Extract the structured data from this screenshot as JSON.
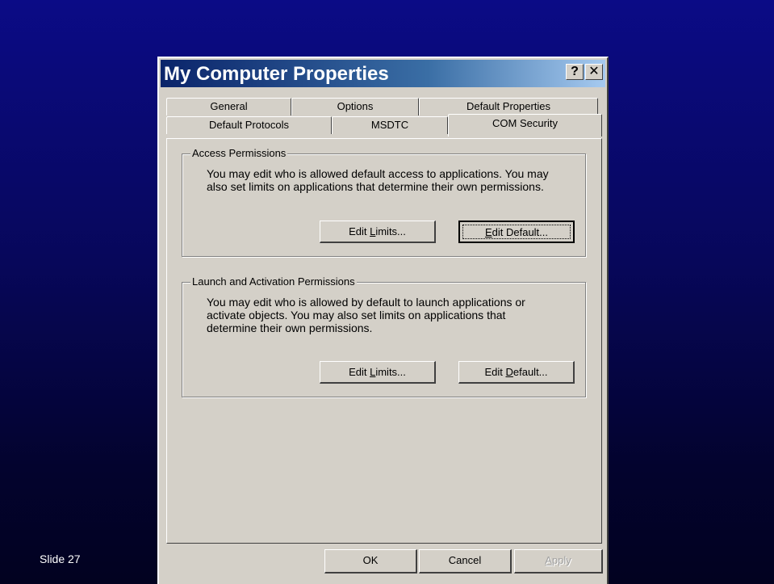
{
  "slide": {
    "label": "Slide 27"
  },
  "window": {
    "title": "My Computer Properties",
    "help_button": "?",
    "close_button": "✕"
  },
  "tabs_row1": [
    {
      "label": "General"
    },
    {
      "label": "Options"
    },
    {
      "label": "Default Properties"
    }
  ],
  "tabs_row2": [
    {
      "label": "Default Protocols"
    },
    {
      "label": "MSDTC"
    },
    {
      "label": "COM Security",
      "active": true
    }
  ],
  "access": {
    "legend": "Access Permissions",
    "description_line1": "You may edit who is allowed default access to applications. You may",
    "description_line2": "also set limits on applications that determine their own permissions.",
    "edit_limits_pre": "Edit ",
    "edit_limits_acc": "L",
    "edit_limits_post": "imits...",
    "edit_default_pre": "",
    "edit_default_acc": "E",
    "edit_default_post": "dit Default..."
  },
  "launch": {
    "legend": "Launch and Activation Permissions",
    "description_line1": "You may edit who is allowed by default to launch applications or",
    "description_line2": "activate objects. You may also set limits on applications that",
    "description_line3": "determine their own permissions.",
    "edit_limits_pre": "Edit ",
    "edit_limits_acc": "L",
    "edit_limits_post": "imits...",
    "edit_default_pre": "Edit ",
    "edit_default_acc": "D",
    "edit_default_post": "efault..."
  },
  "footer": {
    "ok": "OK",
    "cancel": "Cancel",
    "apply_acc": "A",
    "apply_post": "pply"
  }
}
